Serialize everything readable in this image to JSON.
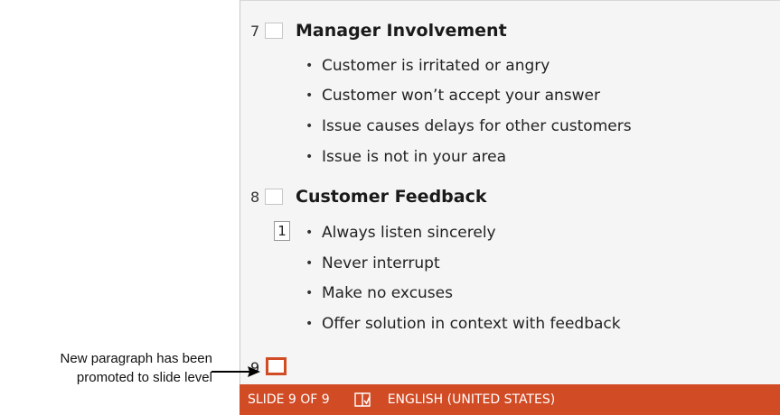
{
  "outline": {
    "slides": [
      {
        "number": "7",
        "title": "Manager Involvement",
        "bullets": [
          "Customer is irritated or angry",
          "Customer won’t accept your answer",
          "Issue causes delays for other customers",
          "Issue is not in your area"
        ]
      },
      {
        "number": "8",
        "title": "Customer Feedback",
        "level_marker": "1",
        "bullets": [
          "Always listen sincerely",
          "Never interrupt",
          "Make no excuses",
          "Offer solution in context with feedback"
        ]
      }
    ],
    "new_slide_number": "9"
  },
  "callout": {
    "line1": "New paragraph has been",
    "line2": "promoted to slide level"
  },
  "status_bar": {
    "slide_indicator": "SLIDE 9 OF 9",
    "notes_icon": "notes-icon",
    "language": "ENGLISH (UNITED STATES)"
  },
  "colors": {
    "accent": "#d14b25",
    "panel_background": "#f5f5f5"
  }
}
